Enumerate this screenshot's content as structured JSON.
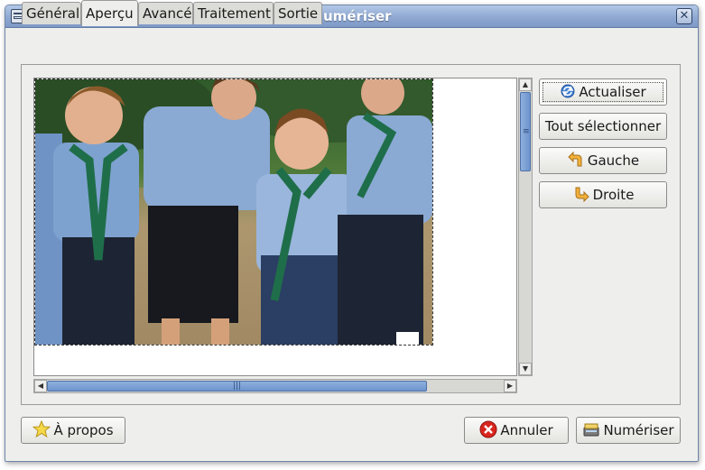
{
  "window": {
    "title": "Numériser"
  },
  "tabs": [
    {
      "label": "Général",
      "active": false
    },
    {
      "label": "Aperçu",
      "active": true
    },
    {
      "label": "Avancé",
      "active": false
    },
    {
      "label": "Traitement",
      "active": false
    },
    {
      "label": "Sortie",
      "active": false
    }
  ],
  "side_buttons": {
    "refresh": "Actualiser",
    "select_all": "Tout sélectionner",
    "left": "Gauche",
    "right": "Droite"
  },
  "footer": {
    "about": "À propos",
    "cancel": "Annuler",
    "scan": "Numériser"
  },
  "colors": {
    "titlebar": "#8ea8d2",
    "scroll_thumb": "#6d94cd",
    "cancel_icon": "#d8251d"
  },
  "icons": {
    "refresh": "refresh-icon",
    "left": "rotate-left-icon",
    "right": "rotate-right-icon",
    "about": "star-icon",
    "cancel": "cancel-icon",
    "scan": "scanner-icon"
  }
}
